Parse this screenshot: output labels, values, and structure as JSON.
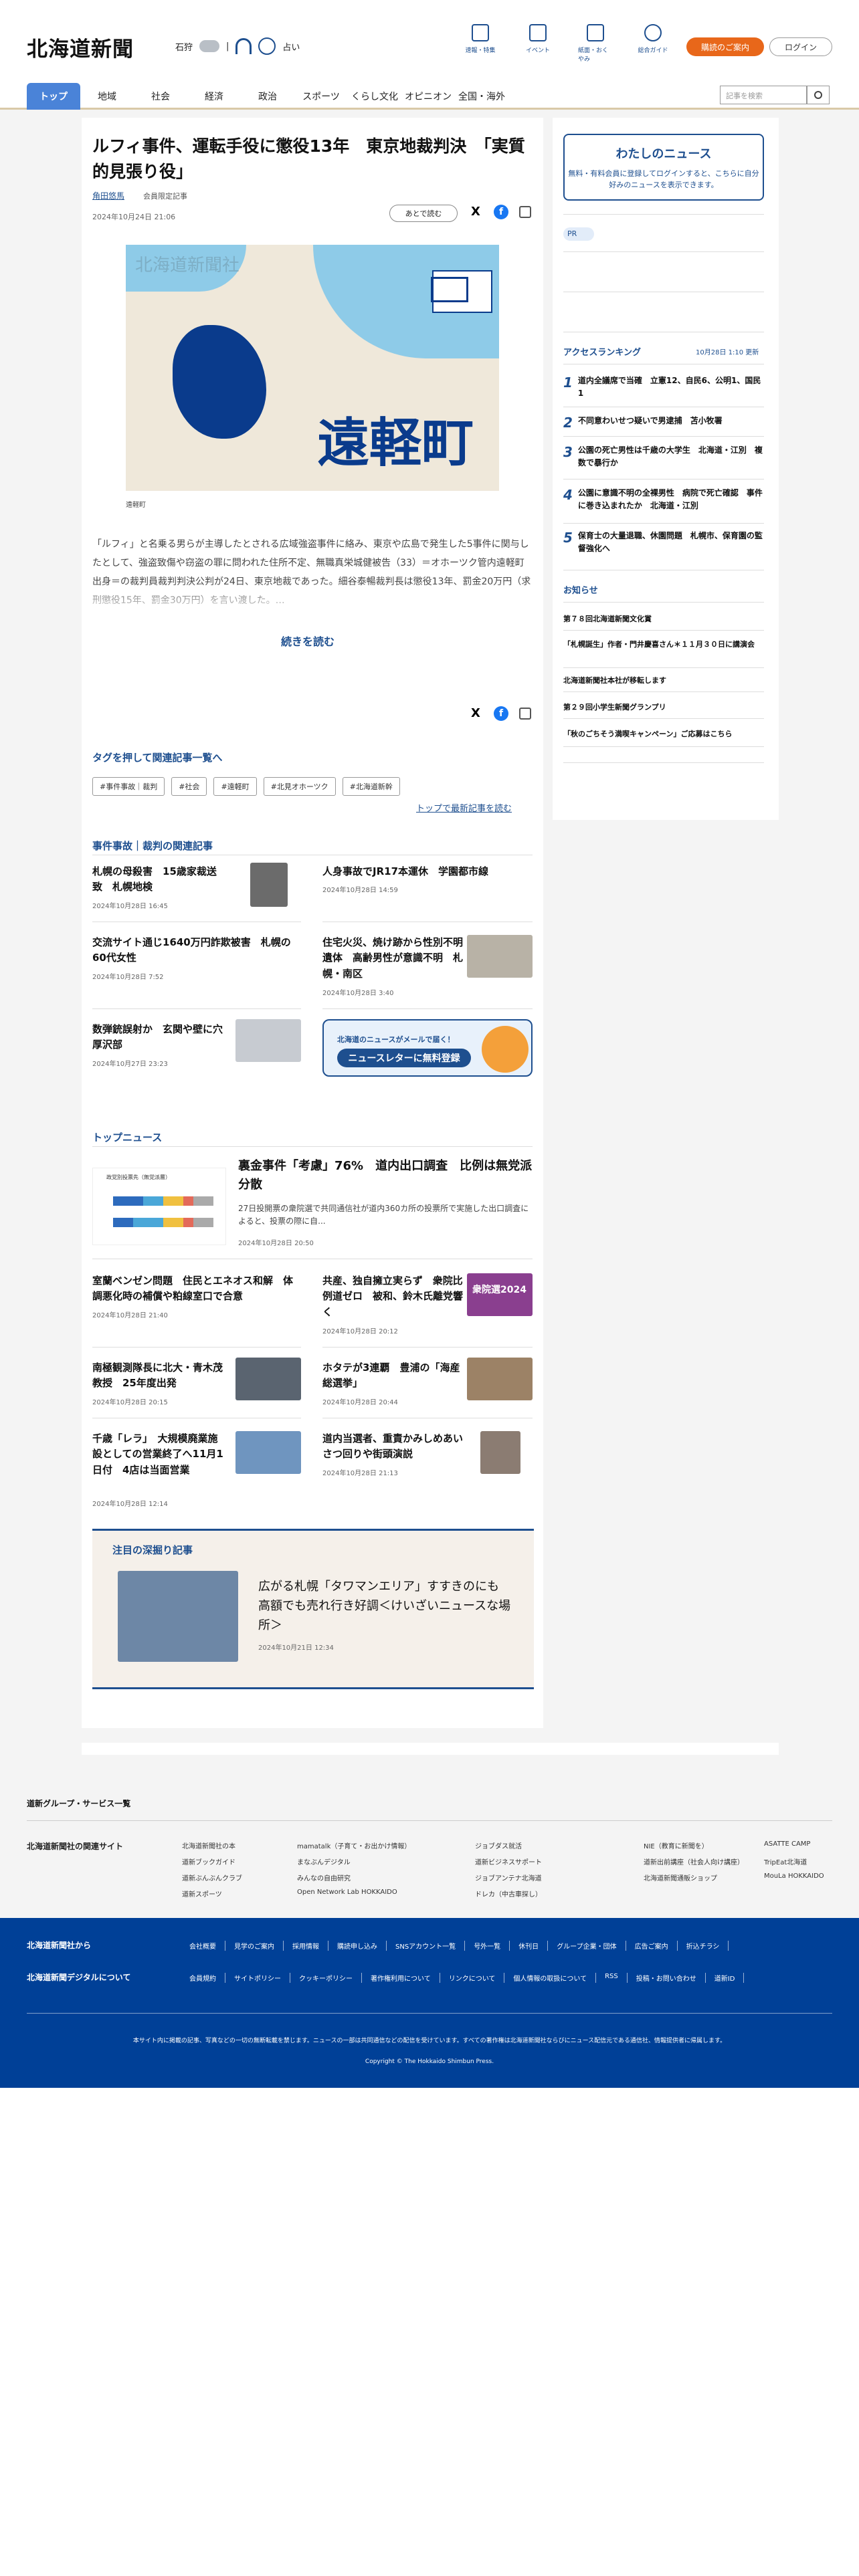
{
  "header": {
    "logo": "北海道新聞",
    "location": "石狩",
    "weather_temp": "|",
    "region_link": "占い",
    "icons": [
      {
        "label": "速報・特集",
        "icon": "flag-icon"
      },
      {
        "label": "イベント",
        "icon": "calendar-icon"
      },
      {
        "label": "紙面・おくやみ",
        "icon": "newspaper-icon"
      },
      {
        "label": "総合ガイド",
        "icon": "help-icon"
      }
    ],
    "info_button": "購読のご案内",
    "login_button": "ログイン"
  },
  "nav": {
    "items": [
      "トップ",
      "地域",
      "社会",
      "経済",
      "政治",
      "スポーツ",
      "くらし文化",
      "オピニオン",
      "全国・海外"
    ],
    "search_placeholder": "記事を検索"
  },
  "article": {
    "title": "ルフィ事件、運転手役に懲役13年　東京地裁判決　「実質的見張り役」",
    "author": "角田悠馬",
    "member_label": "会員限定記事",
    "date": "2024年10月24日 21:06",
    "later_button": "あとで読む",
    "map_watermark": "北海道新聞社",
    "map_label": "遠軽町",
    "caption": "遠軽町",
    "body": "「ルフィ」と名乗る男らが主導したとされる広域強盗事件に絡み、東京や広島で発生した5事件に関与したとして、強盗致傷や窃盗の罪に問われた住所不定、無職真栄城健被告（33）＝オホーツク管内遠軽町出身＝の裁判員裁判判決公判が24日、東京地裁であった。細谷泰暢裁判長は懲役13年、罰金20万円（求刑懲役15年、罰金30万円）を言い渡した。…",
    "read_more": "続きを読む"
  },
  "tags": {
    "heading": "タグを押して関連記事一覧へ",
    "items": [
      "#事件事故｜裁判",
      "#社会",
      "#遠軽町",
      "#北見オホーツク",
      "#北海道新幹"
    ],
    "top_latest": "トップで最新記事を読む"
  },
  "related": {
    "heading": "事件事故｜裁判の関連記事",
    "items": [
      {
        "title": "札幌の母殺害　15歳家裁送致　札幌地検",
        "date": "2024年10月28日 16:45"
      },
      {
        "title": "人身事故でJR17本運休　学園都市線",
        "date": "2024年10月28日 14:59"
      },
      {
        "title": "交流サイト通じ1640万円詐欺被害　札幌の60代女性",
        "date": "2024年10月28日 7:52"
      },
      {
        "title": "住宅火災、焼け跡から性別不明遺体　高齢男性が意識不明　札幌・南区",
        "date": "2024年10月28日 3:40"
      },
      {
        "title": "数弾銃誤射か　玄関や壁に穴　厚沢部",
        "date": "2024年10月27日 23:23"
      }
    ],
    "newsletter_top": "北海道のニュースがメールで届く！",
    "newsletter_main": "ニュースレターに無料登録"
  },
  "topnews": {
    "heading": "トップニュース",
    "lead_title": "裏金事件「考慮」76%　道内出口調査　比例は無党派分散",
    "lead_desc": "27日投開票の衆院選で共同通信社が道内360カ所の投票所で実施した出口調査によると、投票の際に自...",
    "lead_date": "2024年10月28日 20:50",
    "chart_title": "政党別投票先（無党派層）",
    "items": [
      {
        "title": "室蘭ベンゼン問題　住民とエネオス和解　体調悪化時の補償や粕線室口で合意",
        "date": "2024年10月28日 21:40"
      },
      {
        "title": "共産、独自擁立実らず　衆院比例道ゼロ　被和、鈴木氏離党響く",
        "date": "2024年10月28日 20:12"
      },
      {
        "title": "南極観測隊長に北大・青木茂教授　25年度出発",
        "date": "2024年10月28日 20:15"
      },
      {
        "title": "ホタテが3連覇　豊浦の「海産総選挙」",
        "date": "2024年10月28日 20:44"
      },
      {
        "title": "千歳「レラ」　大規模廃業施設としての営業終了へ11月1日付　4店は当面営業",
        "date": "2024年10月28日 12:14"
      },
      {
        "title": "道内当選者、重責かみしめあいさつ回りや街頭演説",
        "date": "2024年10月28日 21:13"
      }
    ],
    "badge": "衆院選2024"
  },
  "deep": {
    "heading": "注目の深掘り記事",
    "title": "広がる札幌「タワマンエリア」すすきのにも　高額でも売れ行き好調＜けいざいニュースな場所＞",
    "date": "2024年10月21日 12:34"
  },
  "sidebar": {
    "my_news_title": "わたしのニュース",
    "my_news_desc": "無料・有料会員に登録してログインすると、こちらに自分好みのニュースを表示できます。",
    "pr_label": "PR",
    "ranking_heading": "アクセスランキング",
    "ranking_updated": "10月28日 1:10 更新",
    "ranking": [
      {
        "n": "1",
        "title": "道内全議席で当確　立憲12、自民6、公明1、国民1"
      },
      {
        "n": "2",
        "title": "不同意わいせつ疑いで男逮捕　苫小牧署"
      },
      {
        "n": "3",
        "title": "公園の死亡男性は千歳の大学生　北海道・江別　複数で暴行か"
      },
      {
        "n": "4",
        "title": "公園に意識不明の全裸男性　病院で死亡確認　事件に巻き込まれたか　北海道・江別"
      },
      {
        "n": "5",
        "title": "保育士の大量退職、休園問題　札幌市、保育園の監督強化へ"
      }
    ],
    "notice_heading": "お知らせ",
    "notices": [
      "第７８回北海道新聞文化賞",
      "「札幌誕生」作者・門井慶喜さん＊１１月３０日に講演会",
      "北海道新聞社本社が移転します",
      "第２９回小学生新聞グランプリ",
      "「秋のごちそう満喫キャンペーン」ご応募はこちら"
    ]
  },
  "group": {
    "heading": "道新グループ・サービス一覧",
    "label": "北海道新聞社の関連サイト",
    "links": [
      [
        "北海道新聞社の本",
        "道新ブックガイド",
        "道新ぶんぶんクラブ",
        "道新スポーツ"
      ],
      [
        "mamatalk（子育て・お出かけ情報）",
        "まなぶんデジタル",
        "みんなの自由研究",
        "Open Network Lab HOKKAIDO"
      ],
      [
        "ジョブダス就活",
        "道新ビジネスサポート",
        "ジョブアンテナ北海道",
        "ドレカ（中古車探し）"
      ],
      [
        "NIE（教育に新聞を）",
        "道新出前講座（社会人向け講座）",
        "北海道新聞通販ショップ"
      ],
      [
        "ASATTE CAMP",
        "TripEat北海道",
        "MouLa HOKKAIDO"
      ]
    ]
  },
  "footer": {
    "row1_label": "北海道新聞社から",
    "row1_links": [
      "会社概要",
      "見学のご案内",
      "採用情報",
      "購読申し込み",
      "SNSアカウント一覧",
      "号外一覧",
      "休刊日",
      "グループ企業・団体",
      "広告ご案内",
      "折込チラシ"
    ],
    "row2_label": "北海道新聞デジタルについて",
    "row2_links": [
      "会員規約",
      "サイトポリシー",
      "クッキーポリシー",
      "著作権利用について",
      "リンクについて",
      "個人情報の取扱について",
      "RSS",
      "投稿・お問い合わせ",
      "道新ID"
    ],
    "note": "本サイト内に掲載の記事、写真などの一切の無断転載を禁じます。ニュースの一部は共同通信などの配信を受けています。すべての著作権は北海道新聞社ならびにニュース配信元である通信社、情報提供者に帰属します。",
    "copyright": "Copyright © The Hokkaido Shimbun Press."
  }
}
